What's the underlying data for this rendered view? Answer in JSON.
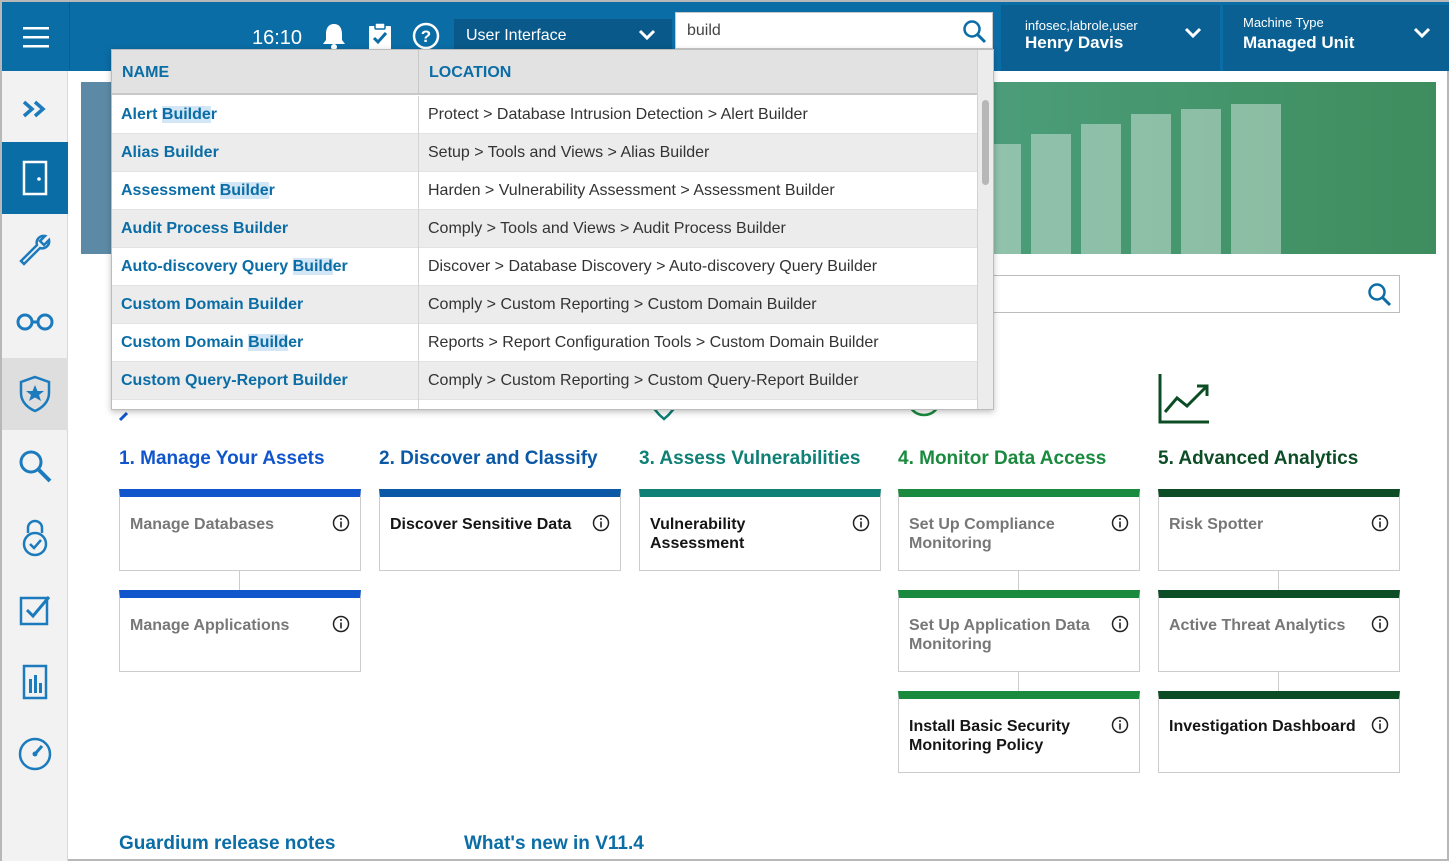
{
  "topbar": {
    "clock": "16:10",
    "ui_select": "User Interface",
    "search_value": "build",
    "user_role": "infosec,labrole,user",
    "user_name": "Henry Davis",
    "machine_label": "Machine Type",
    "machine_value": "Managed Unit"
  },
  "results": {
    "col_name": "NAME",
    "col_location": "LOCATION",
    "rows": [
      {
        "pre": "Alert ",
        "hl": "Builde",
        "post": "r",
        "location": "Protect > Database Intrusion Detection > Alert Builder"
      },
      {
        "pre": "Alias ",
        "hl": "",
        "post": "Builder",
        "location": "Setup > Tools and Views > Alias Builder"
      },
      {
        "pre": "Assessment ",
        "hl": "Builde",
        "post": "r",
        "location": "Harden > Vulnerability Assessment > Assessment Builder"
      },
      {
        "pre": "Audit Process ",
        "hl": "",
        "post": "Builder",
        "location": "Comply > Tools and Views > Audit Process Builder"
      },
      {
        "pre": "Auto-discovery Query ",
        "hl": "Build",
        "post": "er",
        "location": "Discover > Database Discovery > Auto-discovery Query Builder"
      },
      {
        "pre": "Custom Domain ",
        "hl": "",
        "post": "Builder",
        "location": "Comply > Custom Reporting > Custom Domain Builder"
      },
      {
        "pre": "Custom Domain ",
        "hl": "Build",
        "post": "er",
        "location": "Reports > Report Configuration Tools > Custom Domain Builder"
      },
      {
        "pre": "Custom Query-Report ",
        "hl": "",
        "post": "Builder",
        "location": "Comply > Custom Reporting > Custom Query-Report Builder"
      }
    ]
  },
  "steps": [
    {
      "title": "1. Manage Your Assets",
      "color": "#1155cc",
      "cards": [
        "Manage Databases",
        "Manage Applications"
      ]
    },
    {
      "title": "2. Discover and Classify",
      "color": "#0b59a6",
      "cards": [
        "Discover Sensitive Data"
      ]
    },
    {
      "title": "3. Assess Vulnerabilities",
      "color": "#0e8075",
      "cards": [
        "Vulnerability Assessment"
      ]
    },
    {
      "title": "4. Monitor Data Access",
      "color": "#1a8a3f",
      "cards": [
        "Set Up Compliance Monitoring",
        "Set Up Application Data Monitoring",
        "Install Basic Security Monitoring Policy"
      ]
    },
    {
      "title": "5. Advanced Analytics",
      "color": "#0d4d26",
      "cards": [
        "Risk Spotter",
        "Active Threat Analytics",
        "Investigation Dashboard"
      ]
    }
  ],
  "footer": {
    "release_notes": "Guardium release notes",
    "whats_new": "What's new in V11.4"
  },
  "icons": [
    "menu-icon",
    "bell-icon",
    "clipboard-check-icon",
    "help-icon",
    "search-icon",
    "chevron-down-icon",
    "expand-icon",
    "door-icon",
    "wrench-icon",
    "glasses-icon",
    "shield-star-icon",
    "magnifier-icon",
    "lock-check-icon",
    "checkbox-icon",
    "report-icon",
    "gauge-icon",
    "info-icon",
    "chart-line-icon"
  ]
}
